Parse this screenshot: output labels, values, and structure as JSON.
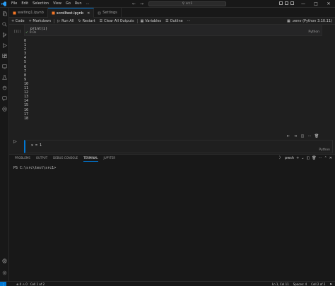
{
  "colors": {
    "accent": "#0078d4",
    "success": "#89d185",
    "background": "#1f1f1f",
    "sidebar": "#181818"
  },
  "menu": [
    "File",
    "Edit",
    "Selection",
    "View",
    "Go",
    "Run",
    "…"
  ],
  "search": {
    "icon": "search-icon",
    "text": "src1"
  },
  "tabs": [
    {
      "label": "waiting1.ipynb",
      "active": false
    },
    {
      "label": "scrolltest.ipynb",
      "active": true
    },
    {
      "label": "Settings",
      "active": false
    }
  ],
  "toolbar": {
    "code": "+ Code",
    "markdown": "+ Markdown",
    "run_all": "Run All",
    "restart": "Restart",
    "clear_all": "Clear All Outputs",
    "variables": "Variables",
    "outline": "Outline",
    "more": "⋯",
    "kernel": ".venv (Python 3.10.11)"
  },
  "cell1": {
    "exec_count": "[11]",
    "code": "print(i)",
    "lang": "Python",
    "status_time": "0.0s",
    "output": [
      "0",
      "1",
      "2",
      "3",
      "4",
      "5",
      "6",
      "7",
      "8",
      "9",
      "10",
      "11",
      "12",
      "13",
      "14",
      "15",
      "16",
      "17",
      "18"
    ]
  },
  "cell2": {
    "code": "x = 1",
    "lang": "Python"
  },
  "panel": {
    "tabs": [
      "PROBLEMS",
      "OUTPUT",
      "DEBUG CONSOLE",
      "TERMINAL",
      "JUPYTER"
    ],
    "active_tab": "TERMINAL",
    "shell": "pwsh",
    "prompt": "PS C:\\src\\test\\src1> "
  },
  "status": {
    "left": [
      "⊗ 0 ⚠ 0",
      "Cell 1 of 2"
    ],
    "right": [
      "Ln 1, Col 11",
      "Spaces: 4",
      "Cell 2 of 2"
    ]
  }
}
